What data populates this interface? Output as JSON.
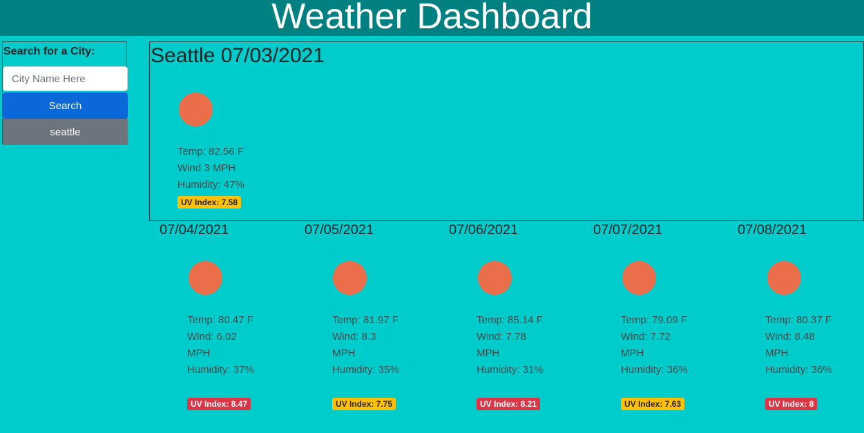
{
  "header": {
    "title": "Weather Dashboard"
  },
  "search": {
    "label": "Search for a City:",
    "placeholder": "City Name Here",
    "value": "",
    "button_label": "Search",
    "history": [
      "seattle"
    ]
  },
  "current": {
    "title": "Seattle 07/03/2021",
    "temp": "Temp: 82.56 F",
    "wind": "Wind 3 MPH",
    "humidity": "Humidity: 47%",
    "uv": "UV Index: 7.58",
    "uv_color": "#ffc107",
    "uv_text_color": "#212529",
    "icon": "sun-icon"
  },
  "forecast": [
    {
      "date": "07/04/2021",
      "temp": "Temp: 80.47 F",
      "wind": "Wind: 6.02 MPH",
      "humidity": "Humidity: 37%",
      "uv": "UV Index: 8.47",
      "uv_color": "#dc3545",
      "uv_text_color": "#ffffff",
      "icon": "sun-icon"
    },
    {
      "date": "07/05/2021",
      "temp": "Temp: 81.97 F",
      "wind": "Wind: 8.3 MPH",
      "humidity": "Humidity: 35%",
      "uv": "UV Index: 7.75",
      "uv_color": "#ffc107",
      "uv_text_color": "#212529",
      "icon": "sun-icon"
    },
    {
      "date": "07/06/2021",
      "temp": "Temp: 85.14 F",
      "wind": "Wind: 7.78 MPH",
      "humidity": "Humidity: 31%",
      "uv": "UV Index: 8.21",
      "uv_color": "#dc3545",
      "uv_text_color": "#ffffff",
      "icon": "sun-icon"
    },
    {
      "date": "07/07/2021",
      "temp": "Temp: 79.09 F",
      "wind": "Wind: 7.72 MPH",
      "humidity": "Humidity: 36%",
      "uv": "UV Index: 7.63",
      "uv_color": "#ffc107",
      "uv_text_color": "#212529",
      "icon": "sun-icon"
    },
    {
      "date": "07/08/2021",
      "temp": "Temp: 80.37 F",
      "wind": "Wind: 8.48 MPH",
      "humidity": "Humidity: 36%",
      "uv": "UV Index: 8",
      "uv_color": "#dc3545",
      "uv_text_color": "#ffffff",
      "icon": "sun-icon"
    }
  ]
}
